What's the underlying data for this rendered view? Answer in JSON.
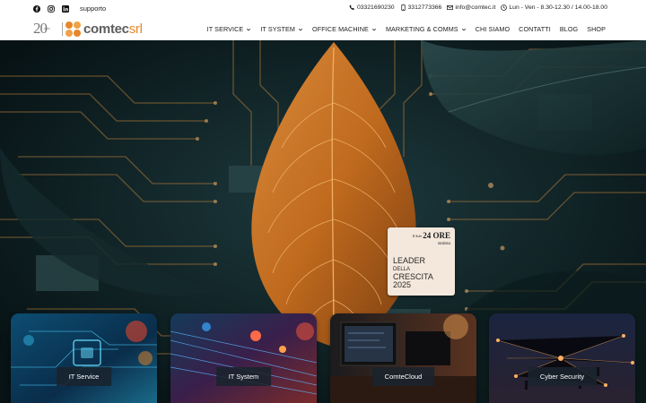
{
  "topbar": {
    "social": [
      {
        "icon": "facebook-icon"
      },
      {
        "icon": "instagram-icon"
      },
      {
        "icon": "linkedin-icon"
      }
    ],
    "support_label": "supporto",
    "phone1": "03321690230",
    "phone2": "3312773366",
    "email": "info@comtec.it",
    "hours": "Lun - Ven - 8.30-12.30 / 14.00-18.00"
  },
  "logo": {
    "anniversary": "20",
    "anniversary_sub": "anni",
    "brand": "comtec",
    "brand_suffix": "srl",
    "colors": {
      "orange": "#e8862a",
      "light_orange": "#f0a246",
      "grey": "#5d5d5d"
    }
  },
  "nav": {
    "items": [
      {
        "label": "IT SERVICE",
        "dropdown": true
      },
      {
        "label": "IT SYSTEM",
        "dropdown": true
      },
      {
        "label": "OFFICE MACHINE",
        "dropdown": true
      },
      {
        "label": "MARKETING & COMMS",
        "dropdown": true
      },
      {
        "label": "CHI SIAMO",
        "dropdown": false
      },
      {
        "label": "CONTATTI",
        "dropdown": false
      },
      {
        "label": "BLOG",
        "dropdown": false
      },
      {
        "label": "SHOP",
        "dropdown": false
      }
    ]
  },
  "badge": {
    "newspaper": "24 ORE",
    "newspaper_prefix": "Il Sole",
    "partner": "statista",
    "line1": "LEADER",
    "line2": "DELLA",
    "line3": "CRESCITA",
    "year": "2025"
  },
  "cards": [
    {
      "label": "IT Service"
    },
    {
      "label": "IT System"
    },
    {
      "label": "ComteCloud"
    },
    {
      "label": "Cyber Security"
    }
  ]
}
